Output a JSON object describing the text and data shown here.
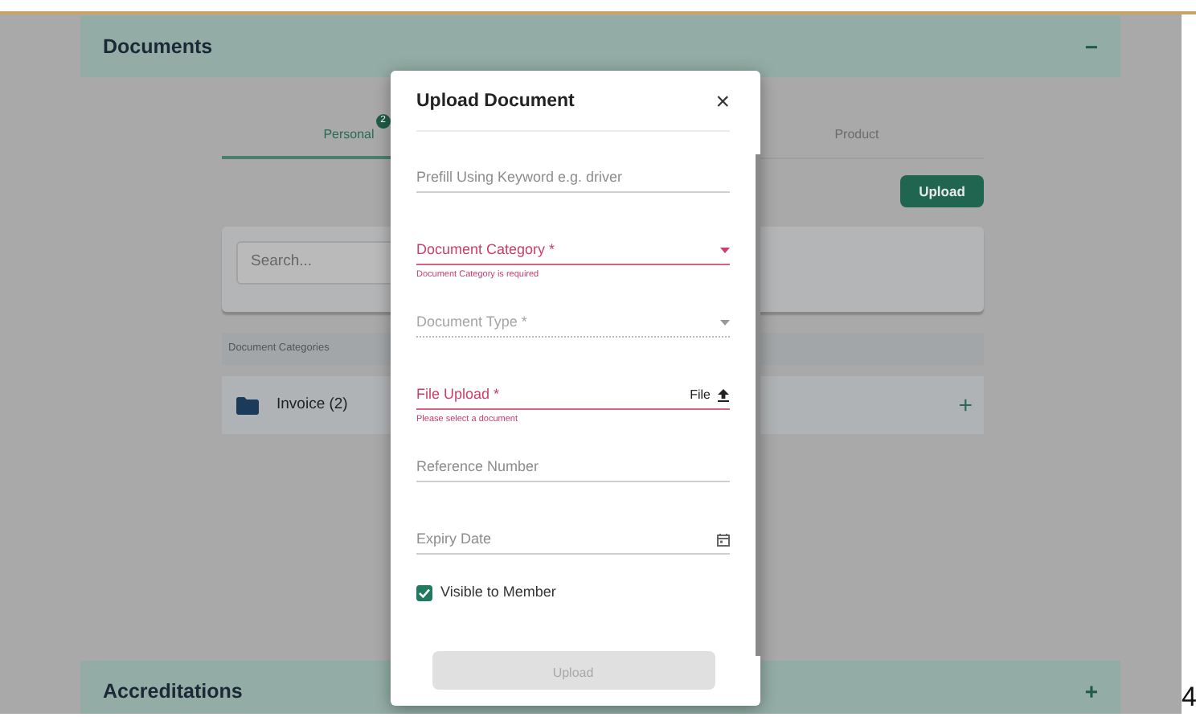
{
  "header_panel": {
    "title": "Documents",
    "toggle": "−"
  },
  "tabs": [
    {
      "label": "Personal",
      "badge": "2",
      "selected": true
    },
    {
      "label": "Product",
      "selected": false
    }
  ],
  "upload_button": "Upload",
  "search": {
    "placeholder": "Search..."
  },
  "categories_header": "Document Categories",
  "categories": [
    {
      "name": "Invoice (2)",
      "expand": "+"
    }
  ],
  "footer_panel": {
    "title": "Accreditations",
    "toggle": "+"
  },
  "modal": {
    "title": "Upload Document",
    "close": "×",
    "fields": [
      {
        "kind": "text",
        "placeholder": "Prefill Using Keyword e.g. driver",
        "invalid": false,
        "disabled": false
      },
      {
        "kind": "select",
        "placeholder": "Document Category *",
        "invalid": true,
        "disabled": false,
        "error": "Document Category is required"
      },
      {
        "kind": "select",
        "placeholder": "Document Type *",
        "invalid": false,
        "disabled": true
      },
      {
        "kind": "file",
        "placeholder": "File Upload *",
        "action": "File",
        "invalid": true,
        "disabled": false,
        "error": "Please select a document"
      },
      {
        "kind": "text",
        "placeholder": "Reference Number",
        "invalid": false,
        "disabled": false
      },
      {
        "kind": "date",
        "placeholder": "Expiry Date",
        "invalid": false,
        "disabled": false
      }
    ],
    "checkbox": {
      "label": "Visible to Member",
      "checked": true
    },
    "submit": {
      "label": "Upload",
      "disabled": true
    }
  },
  "page_number": "4"
}
